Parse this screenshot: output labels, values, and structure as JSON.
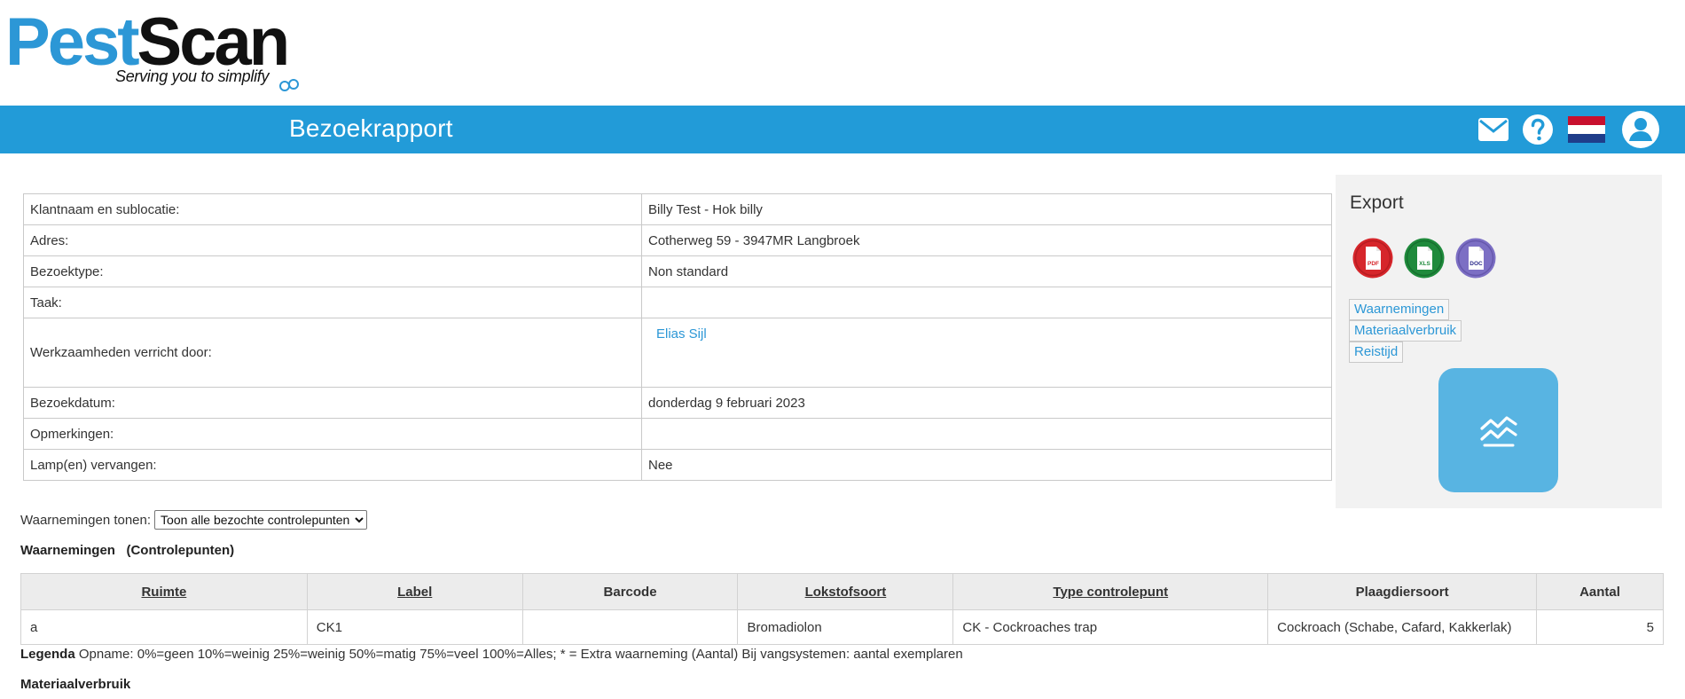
{
  "logo": {
    "part1": "Pest",
    "part2": "Scan",
    "tagline": "Serving you to simplify"
  },
  "header": {
    "title": "Bezoekrapport"
  },
  "topbar_icons": [
    "mail-icon",
    "help-icon",
    "dutch-flag-icon",
    "user-icon"
  ],
  "info": {
    "client_label": "Klantnaam en sublocatie:",
    "client_value": "Billy Test - Hok billy",
    "address_label": "Adres:",
    "address_value": "Cotherweg 59 - 3947MR Langbroek",
    "visit_type_label": "Bezoektype:",
    "visit_type_value": "Non standard",
    "task_label": "Taak:",
    "task_value": "",
    "performed_by_label": "Werkzaamheden verricht door:",
    "performed_by_value": "Elias Sijl",
    "visit_date_label": "Bezoekdatum:",
    "visit_date_value": "donderdag 9 februari 2023",
    "remarks_label": "Opmerkingen:",
    "remarks_value": "",
    "lamps_label": "Lamp(en) vervangen:",
    "lamps_value": "Nee"
  },
  "export": {
    "title": "Export",
    "formats": [
      {
        "name": "pdf-icon",
        "label": "PDF",
        "color": "#d6262b"
      },
      {
        "name": "xls-icon",
        "label": "XLS",
        "color": "#1f8a3c"
      },
      {
        "name": "doc-icon",
        "label": "DOC",
        "color": "#7c6fc4"
      }
    ],
    "links": [
      "Waarnemingen",
      "Materiaalverbruik",
      "Reistijd"
    ]
  },
  "filter": {
    "label": "Waarnemingen tonen:",
    "selected": "Toon alle bezochte controlepunten"
  },
  "observations": {
    "title": "Waarnemingen   (Controlepunten)",
    "headers": [
      "Ruimte",
      "Label",
      "Barcode",
      "Lokstofsoort",
      "Type controlepunt",
      "Plaagdiersoort",
      "Aantal"
    ],
    "rows": [
      [
        "a",
        "CK1",
        "",
        "Bromadiolon",
        "CK - Cockroaches trap",
        "Cockroach (Schabe, Cafard, Kakkerlak)",
        "5"
      ]
    ]
  },
  "legend": {
    "bold": "Legenda",
    "text": " Opname: 0%=geen 10%=weinig 25%=weinig 50%=matig 75%=veel 100%=Alles; * = Extra waarneming (Aantal) Bij vangsystemen: aantal exemplaren"
  },
  "material": {
    "title": "Materiaalverbruik"
  },
  "colors": {
    "brand_blue": "#229bd8",
    "link_blue": "#2c97d6",
    "button_blue": "#58b4e2"
  }
}
